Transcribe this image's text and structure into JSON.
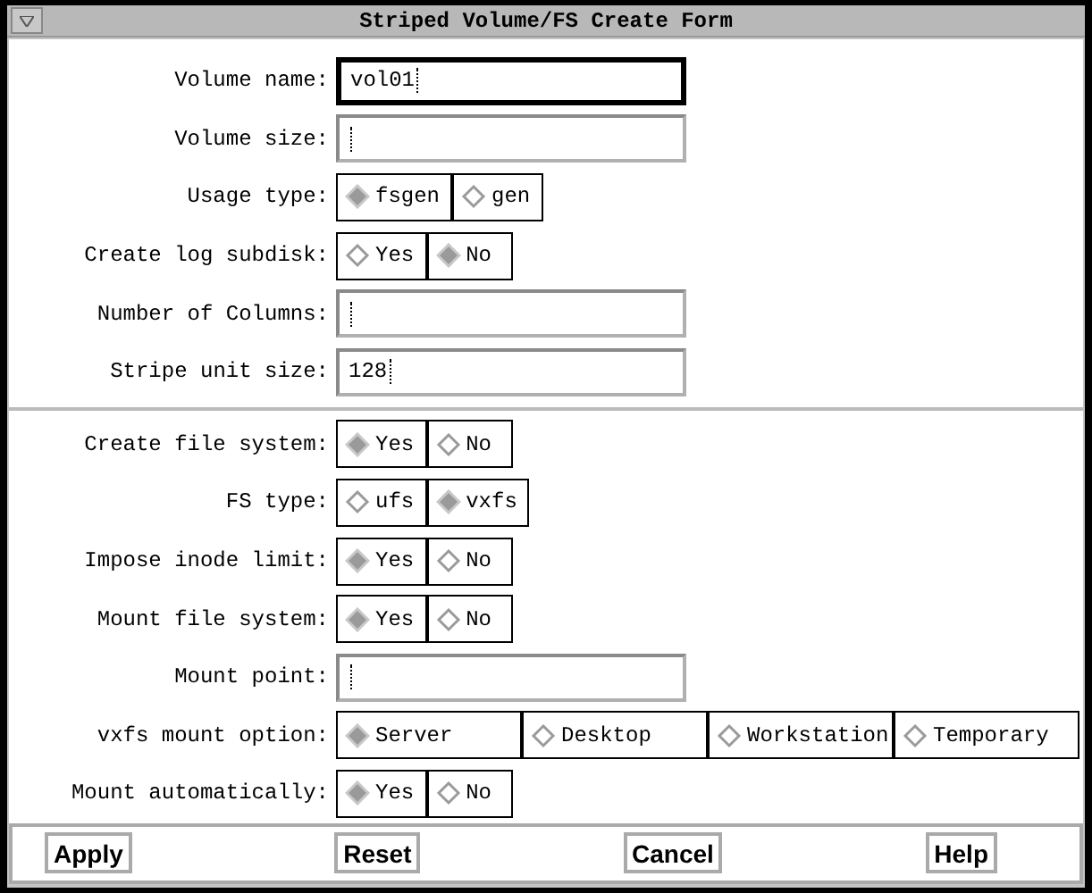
{
  "window": {
    "title": "Striped Volume/FS Create Form"
  },
  "sections": [
    {
      "rows": [
        {
          "kind": "text",
          "label": "Volume name:",
          "value": "vol01",
          "focused": true
        },
        {
          "kind": "text",
          "label": "Volume size:",
          "value": "",
          "focused": false
        },
        {
          "kind": "choice",
          "label": "Usage type:",
          "options": [
            {
              "label": "fsgen",
              "selected": true
            },
            {
              "label": "gen",
              "selected": false
            }
          ]
        },
        {
          "kind": "choice",
          "label": "Create log subdisk:",
          "options": [
            {
              "label": "Yes",
              "selected": false
            },
            {
              "label": "No",
              "selected": true
            }
          ]
        },
        {
          "kind": "text",
          "label": "Number of Columns:",
          "value": "",
          "focused": false
        },
        {
          "kind": "text",
          "label": "Stripe unit size:",
          "value": "128",
          "focused": false
        }
      ]
    },
    {
      "rows": [
        {
          "kind": "choice",
          "label": "Create file system:",
          "options": [
            {
              "label": "Yes",
              "selected": true
            },
            {
              "label": "No",
              "selected": false
            }
          ]
        },
        {
          "kind": "choice",
          "label": "FS type:",
          "options": [
            {
              "label": "ufs",
              "selected": false
            },
            {
              "label": "vxfs",
              "selected": true
            }
          ]
        },
        {
          "kind": "choice",
          "label": "Impose inode limit:",
          "options": [
            {
              "label": "Yes",
              "selected": true
            },
            {
              "label": "No",
              "selected": false
            }
          ]
        },
        {
          "kind": "choice",
          "label": "Mount file system:",
          "options": [
            {
              "label": "Yes",
              "selected": true
            },
            {
              "label": "No",
              "selected": false
            }
          ]
        },
        {
          "kind": "text",
          "label": "Mount point:",
          "value": "",
          "focused": false
        },
        {
          "kind": "choice",
          "label": "vxfs mount option:",
          "options": [
            {
              "label": "Server",
              "selected": true
            },
            {
              "label": "Desktop",
              "selected": false
            },
            {
              "label": "Workstation",
              "selected": false
            },
            {
              "label": "Temporary",
              "selected": false
            }
          ]
        },
        {
          "kind": "choice",
          "label": "Mount automatically:",
          "options": [
            {
              "label": "Yes",
              "selected": true
            },
            {
              "label": "No",
              "selected": false
            }
          ]
        }
      ]
    }
  ],
  "buttons": [
    "Apply",
    "Reset",
    "Cancel",
    "Help"
  ]
}
